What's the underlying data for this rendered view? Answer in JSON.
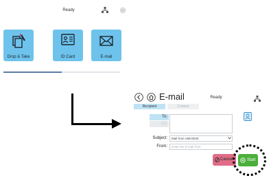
{
  "home": {
    "status": "Ready",
    "tiles": [
      {
        "label": "Drop & Take",
        "icon": "drop-take-icon"
      },
      {
        "label": "ID Card",
        "icon": "id-card-icon"
      },
      {
        "label": "E-mail",
        "icon": "envelope-icon"
      }
    ],
    "progress": 0.5
  },
  "email": {
    "title": "E-mail",
    "status": "Ready",
    "tabs": [
      "Recipient",
      "Content"
    ],
    "fields": {
      "to_label": "To:",
      "cc_label": "Cc:",
      "subject_label": "Subject:",
      "subject_value": "Mail from AMH3040",
      "from_label": "From:",
      "from_placeholder": "Enter the E-mail from"
    },
    "buttons": {
      "cancel": "Cancel",
      "start": "Start"
    }
  },
  "colors": {
    "tile": "#6ec3ec",
    "tab_active": "#bfe3f5",
    "start": "#4caf3c",
    "cancel": "#e06c88"
  }
}
